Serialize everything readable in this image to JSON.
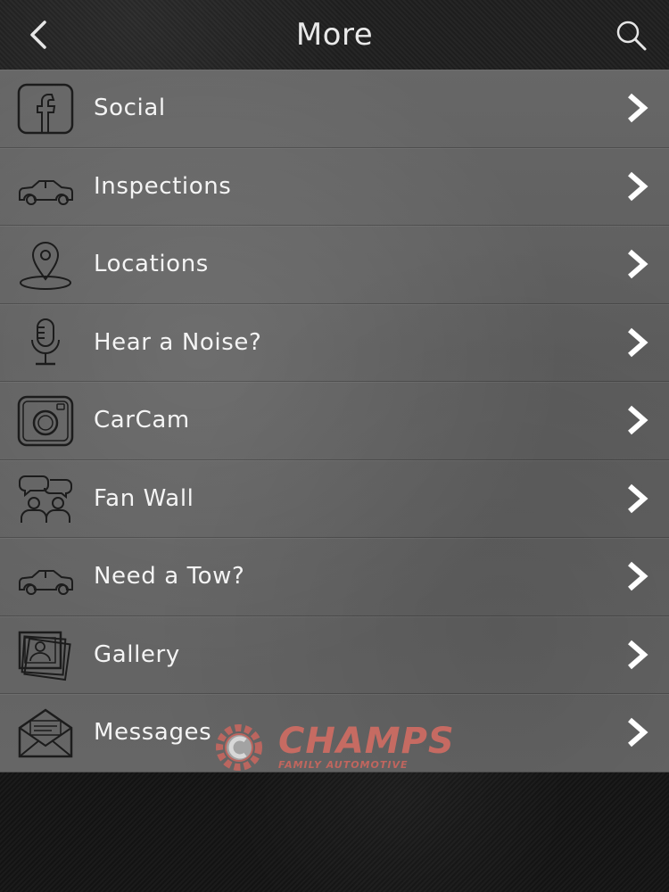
{
  "header": {
    "title": "More"
  },
  "menu": {
    "items": [
      {
        "label": "Social",
        "icon": "facebook-icon"
      },
      {
        "label": "Inspections",
        "icon": "car-icon"
      },
      {
        "label": "Locations",
        "icon": "map-pin-icon"
      },
      {
        "label": "Hear a Noise?",
        "icon": "microphone-icon"
      },
      {
        "label": "CarCam",
        "icon": "camera-icon"
      },
      {
        "label": "Fan Wall",
        "icon": "people-chat-icon"
      },
      {
        "label": "Need a Tow?",
        "icon": "car-icon"
      },
      {
        "label": "Gallery",
        "icon": "photos-icon"
      },
      {
        "label": "Messages",
        "icon": "envelope-icon"
      }
    ]
  },
  "brand": {
    "name": "CHAMPS",
    "tagline": "FAMILY AUTOMOTIVE"
  },
  "colors": {
    "text": "#f4f4f4",
    "brand": "#e06e63",
    "header_bg": "#222222"
  }
}
